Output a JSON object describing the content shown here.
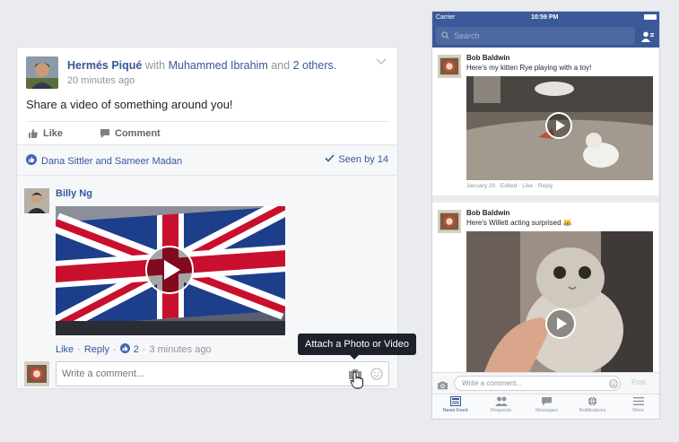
{
  "desktop_post": {
    "author": "Hermés Piqué",
    "with_word": "with",
    "tagged_person": "Muhammed Ibrahim",
    "and_word": "and",
    "others": "2 others.",
    "time": "20 minutes ago",
    "text": "Share a video of something around you!",
    "like_label": "Like",
    "comment_label": "Comment",
    "tagged_summary": "Dana Sittler and Sameer Madan",
    "seen_label": "Seen by 14"
  },
  "desktop_comment": {
    "author": "Billy Ng",
    "like_label": "Like",
    "reply_label": "Reply",
    "separator": "·",
    "like_count": "2",
    "time": "3 minutes ago"
  },
  "desktop_composer": {
    "placeholder": "Write a comment..."
  },
  "tooltip": {
    "text": "Attach a Photo or Video"
  },
  "mobile": {
    "carrier": "Carrier",
    "clock": "10:59 PM",
    "search_placeholder": "Search",
    "posts": [
      {
        "author": "Bob Baldwin",
        "text": "Here's my kitten Rye playing with a toy!",
        "meta": "January 20 · Edited · Like · Reply"
      },
      {
        "author": "Bob Baldwin",
        "text": "Here's Willett acting surprised 😹"
      }
    ],
    "composer_placeholder": "Write a comment...",
    "post_button": "Post",
    "tabs": [
      "News Feed",
      "Requests",
      "Messages",
      "Notifications",
      "More"
    ]
  },
  "colors": {
    "brand": "#3b5998",
    "link": "#365899",
    "muted": "#90949c"
  }
}
